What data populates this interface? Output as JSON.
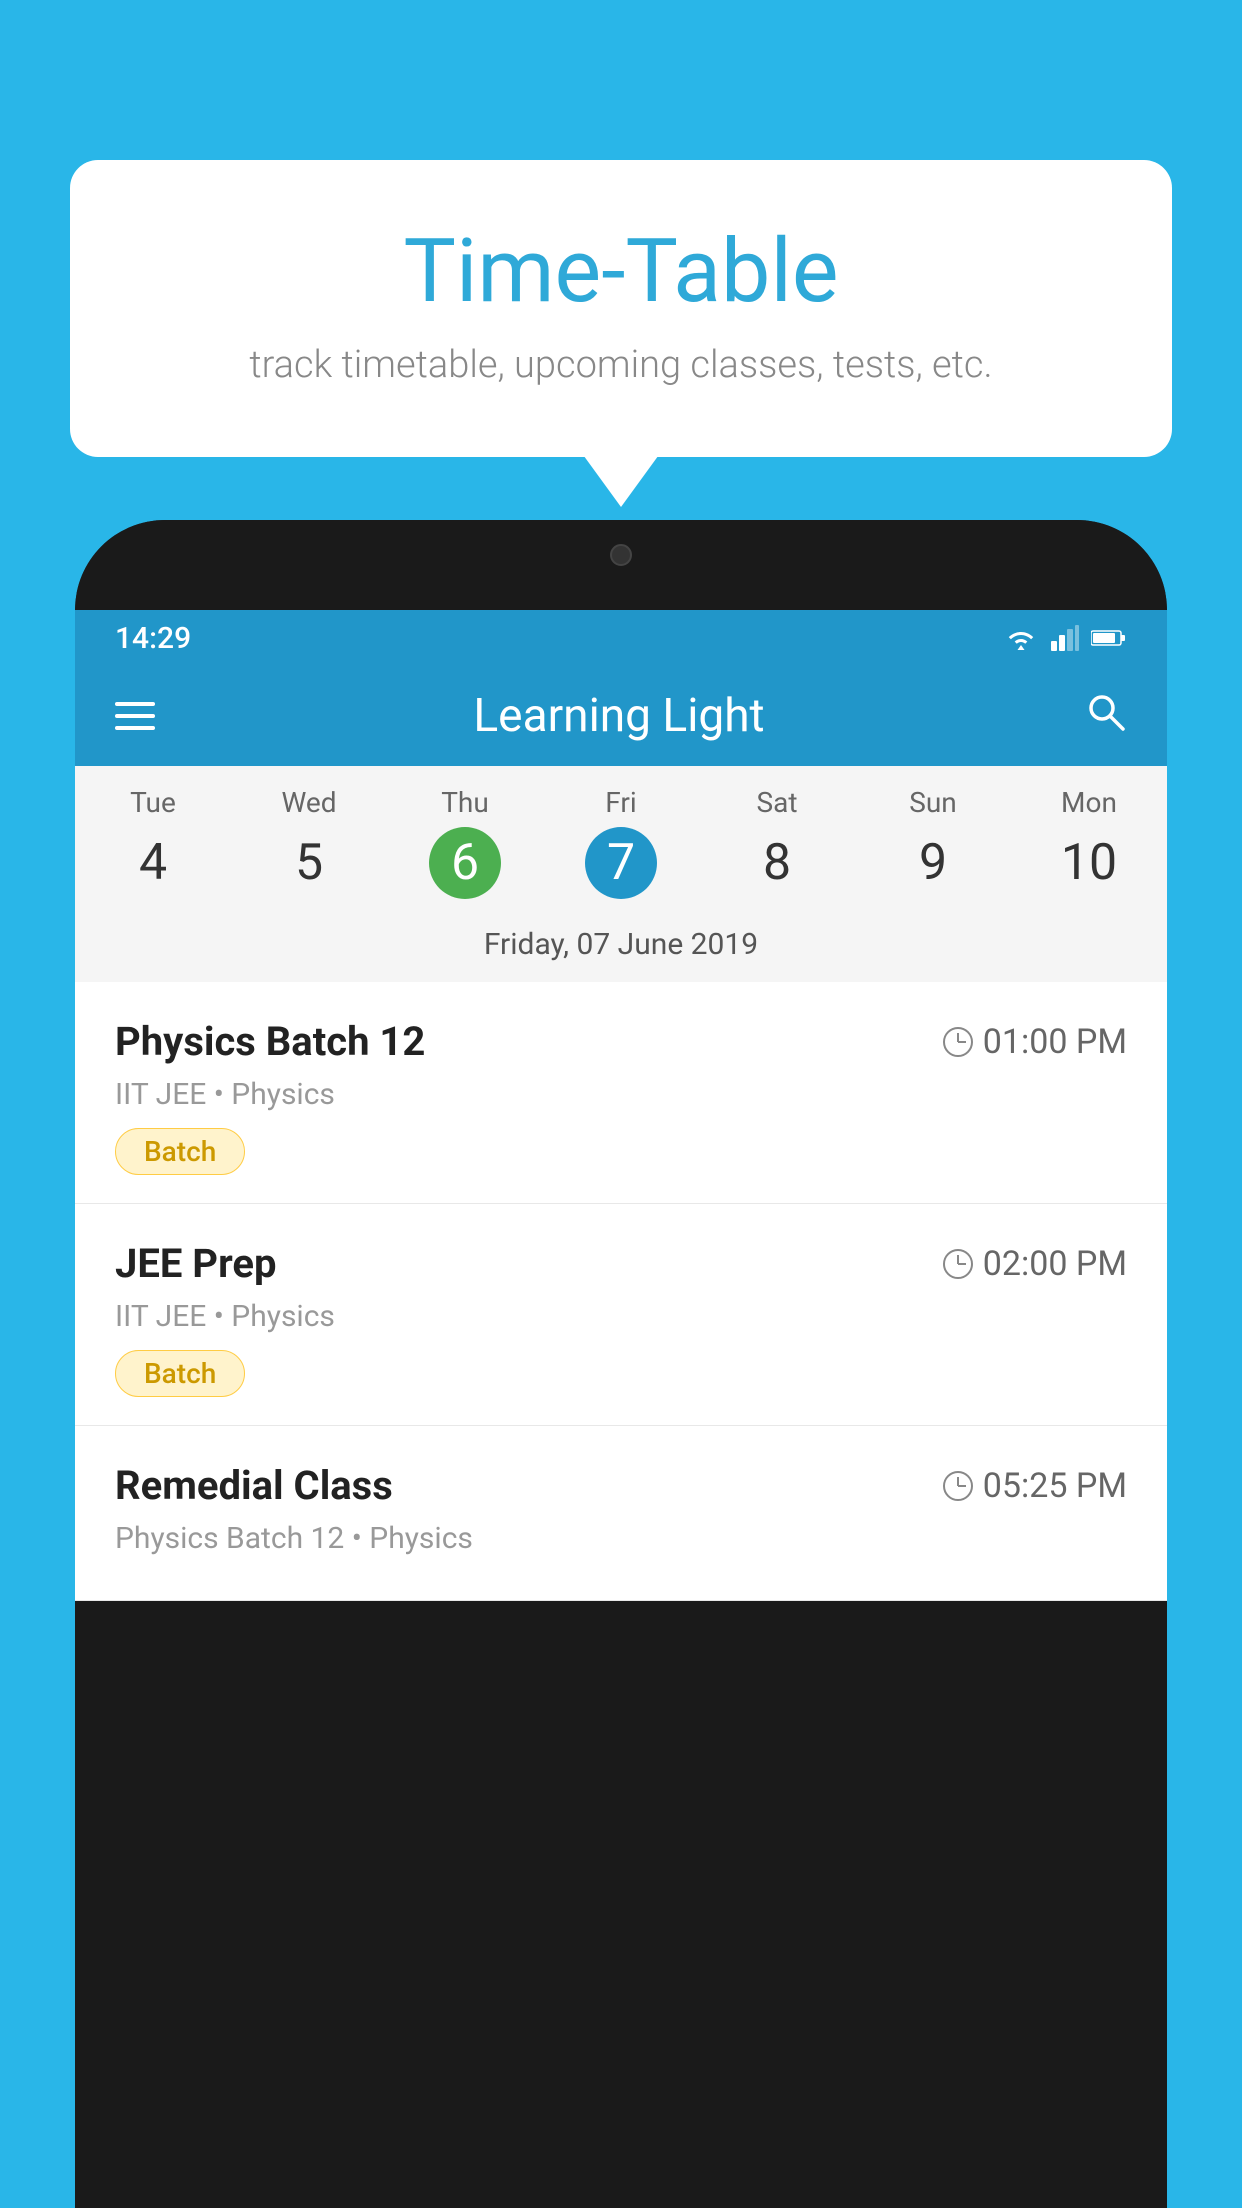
{
  "background_color": "#29B6E8",
  "speech_bubble": {
    "title": "Time-Table",
    "subtitle": "track timetable, upcoming classes, tests, etc."
  },
  "status_bar": {
    "time": "14:29",
    "icons": [
      "wifi",
      "signal",
      "battery"
    ]
  },
  "app_header": {
    "title": "Learning Light",
    "menu_icon": "hamburger-icon",
    "search_icon": "search-icon"
  },
  "calendar": {
    "days": [
      {
        "name": "Tue",
        "number": "4",
        "state": "normal"
      },
      {
        "name": "Wed",
        "number": "5",
        "state": "normal"
      },
      {
        "name": "Thu",
        "number": "6",
        "state": "today"
      },
      {
        "name": "Fri",
        "number": "7",
        "state": "selected"
      },
      {
        "name": "Sat",
        "number": "8",
        "state": "normal"
      },
      {
        "name": "Sun",
        "number": "9",
        "state": "normal"
      },
      {
        "name": "Mon",
        "number": "10",
        "state": "normal"
      }
    ],
    "selected_date_label": "Friday, 07 June 2019"
  },
  "schedule_items": [
    {
      "title": "Physics Batch 12",
      "time": "01:00 PM",
      "subject": "IIT JEE • Physics",
      "tag": "Batch"
    },
    {
      "title": "JEE Prep",
      "time": "02:00 PM",
      "subject": "IIT JEE • Physics",
      "tag": "Batch"
    },
    {
      "title": "Remedial Class",
      "time": "05:25 PM",
      "subject": "Physics Batch 12 • Physics",
      "tag": ""
    }
  ]
}
